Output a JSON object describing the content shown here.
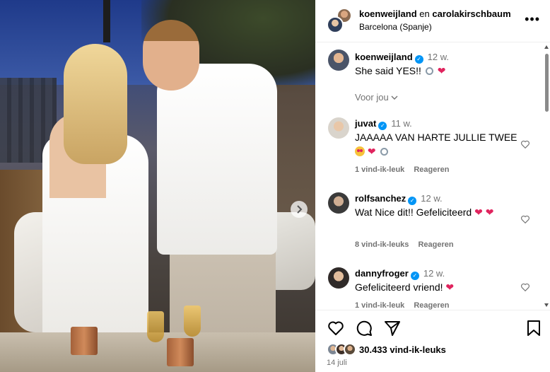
{
  "post": {
    "header": {
      "user1": "koenweijland",
      "connector": "en",
      "user2": "carolakirschbaum",
      "location": "Barcelona (Spanje)",
      "more_icon": "more-horizontal-icon"
    },
    "caption": {
      "username": "koenweijland",
      "time": "12 w.",
      "text": "She said YES!!"
    },
    "voor_jou": "Voor jou",
    "comments": [
      {
        "username": "juvat",
        "time": "11 w.",
        "text": "JAAAAA VAN HARTE JULLIE TWEE",
        "likes": "1 vind-ik-leuk",
        "reply": "Reageren"
      },
      {
        "username": "rolfsanchez",
        "time": "12 w.",
        "text": "Wat Nice dit!! Gefeliciteerd",
        "likes": "8 vind-ik-leuks",
        "reply": "Reageren"
      },
      {
        "username": "dannyfroger",
        "time": "12 w.",
        "text": "Gefeliciteerd vriend!",
        "likes": "1 vind-ik-leuk",
        "reply": "Reageren"
      }
    ],
    "likes_count": "30.433 vind-ik-leuks",
    "date": "14 juli"
  },
  "colors": {
    "verified": "#0095f6",
    "heart": "#e0245e",
    "muted": "#737373"
  }
}
